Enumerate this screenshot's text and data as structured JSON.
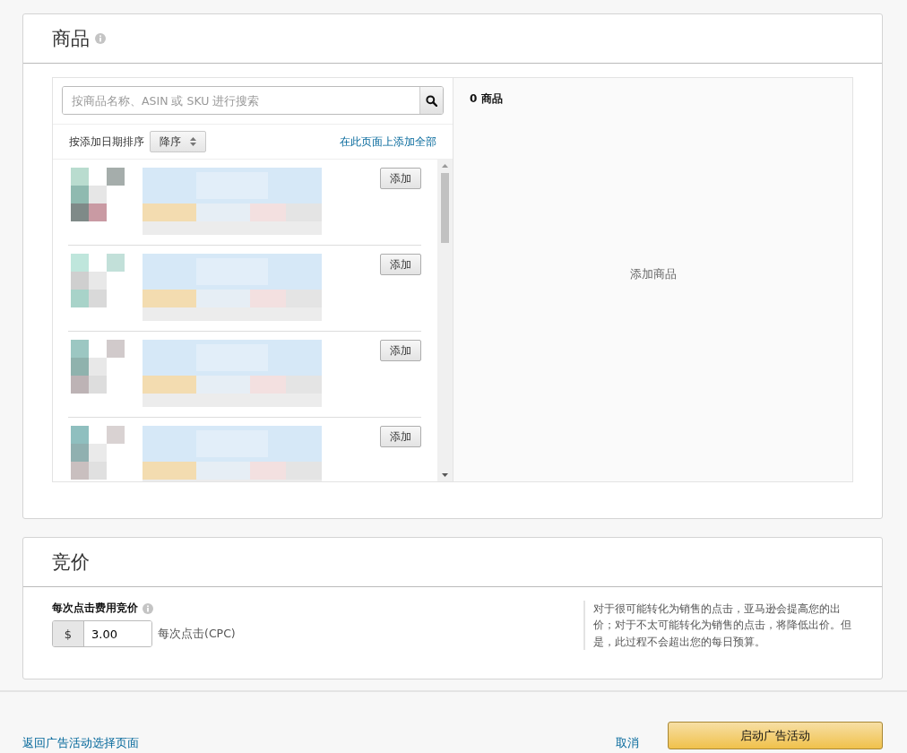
{
  "products_section": {
    "title": "商品",
    "search": {
      "placeholder": "按商品名称、ASIN 或 SKU 进行搜索"
    },
    "sort_label": "按添加日期排序",
    "sort_value": "降序",
    "add_all_link": "在此页面上添加全部",
    "items": [
      {
        "button": "添加"
      },
      {
        "button": "添加"
      },
      {
        "button": "添加"
      },
      {
        "button": "添加"
      }
    ],
    "selected_count": "0 商品",
    "empty_text": "添加商品"
  },
  "bid_section": {
    "title": "竞价",
    "field_label": "每次点击费用竞价",
    "currency": "$",
    "value": "3.00",
    "unit": "每次点击(CPC)",
    "note": "对于很可能转化为销售的点击，亚马逊会提高您的出价；对于不太可能转化为销售的点击，将降低出价。但是，此过程不会超出您的每日预算。"
  },
  "footer": {
    "back_link": "返回广告活动选择页面",
    "cancel": "取消",
    "submit": "启动广告活动"
  }
}
